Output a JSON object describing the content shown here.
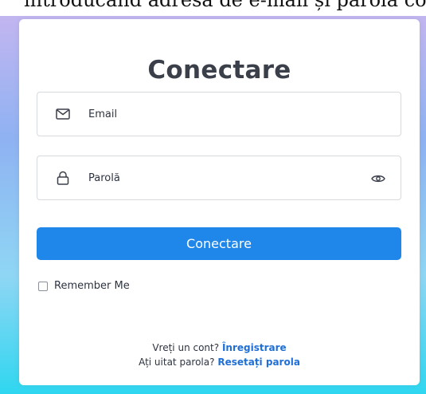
{
  "top_text": "introducând adresa de e-mail și parola corespunzătoare",
  "login": {
    "title": "Conectare",
    "email_label": "Email",
    "password_label": "Parolă",
    "submit_label": "Conectare",
    "remember_label": "Remember Me",
    "register_prompt": "Vreți un cont?",
    "register_link": "Înregistrare",
    "forgot_prompt": "Ați uitat parola?",
    "forgot_link": "Resetați parola"
  },
  "icons": {
    "email": "envelope-icon",
    "password": "lock-icon",
    "toggle": "eye-icon"
  },
  "colors": {
    "primary": "#1f86ea",
    "link": "#1f6fd6",
    "title": "#3a3f4a"
  }
}
